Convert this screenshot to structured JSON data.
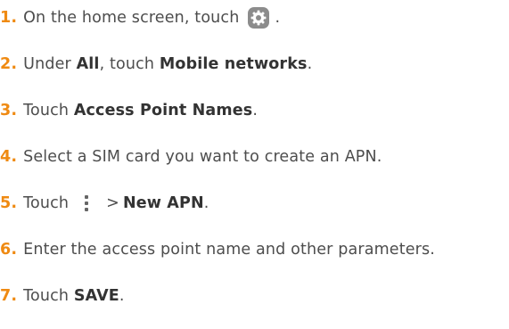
{
  "steps": [
    {
      "number": "1.",
      "text_before": "On the home screen, touch",
      "icon": "settings-gear-icon",
      "text_after": "."
    },
    {
      "number": "2.",
      "text_1": "Under ",
      "bold_1": "All",
      "text_2": ", touch ",
      "bold_2": "Mobile networks",
      "text_3": "."
    },
    {
      "number": "3.",
      "text_1": "Touch ",
      "bold_1": "Access Point Names",
      "text_2": "."
    },
    {
      "number": "4.",
      "text_1": "Select a SIM card you want to create an APN."
    },
    {
      "number": "5.",
      "text_1": "Touch",
      "icon": "more-menu-icon",
      "separator": ">",
      "bold_1": "New APN",
      "text_2": "."
    },
    {
      "number": "6.",
      "text_1": "Enter the access point name and other parameters."
    },
    {
      "number": "7.",
      "text_1": "Touch ",
      "bold_1": "SAVE",
      "text_2": "."
    }
  ],
  "colors": {
    "step_number": "#ef8a12",
    "body_text": "#4d4d4d",
    "icon_gray": "#8c8c8c"
  }
}
